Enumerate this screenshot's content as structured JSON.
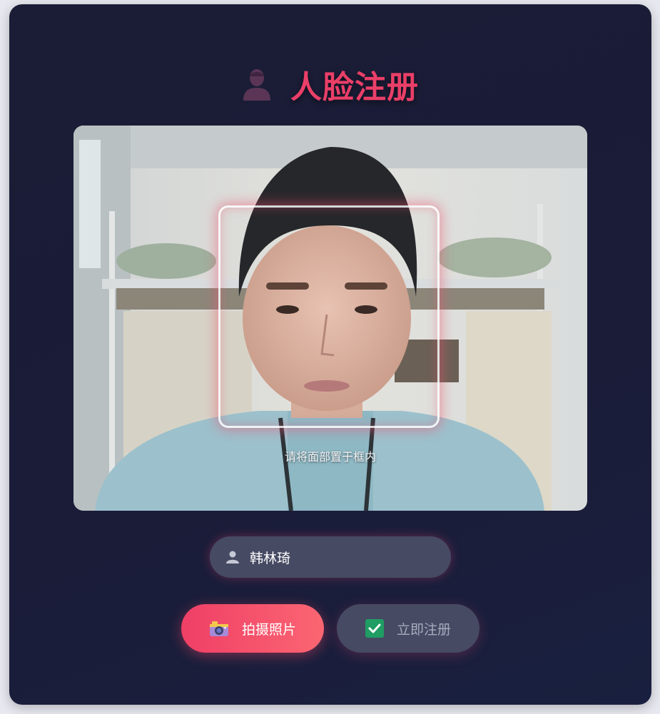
{
  "header": {
    "title": "人脸注册",
    "icon": "person-silhouette-icon"
  },
  "camera": {
    "hint": "请将面部置于框内",
    "frame": "face-guide-frame"
  },
  "form": {
    "name_value": "韩林琦",
    "name_icon": "user-icon"
  },
  "actions": {
    "capture_label": "拍摄照片",
    "capture_icon": "camera-icon",
    "register_label": "立即注册",
    "register_icon": "check-box-icon"
  },
  "colors": {
    "accent": "#ea3f68",
    "card_bg": "#1b1d36",
    "field_bg": "#464a63",
    "register_check": "#1f9d63"
  }
}
